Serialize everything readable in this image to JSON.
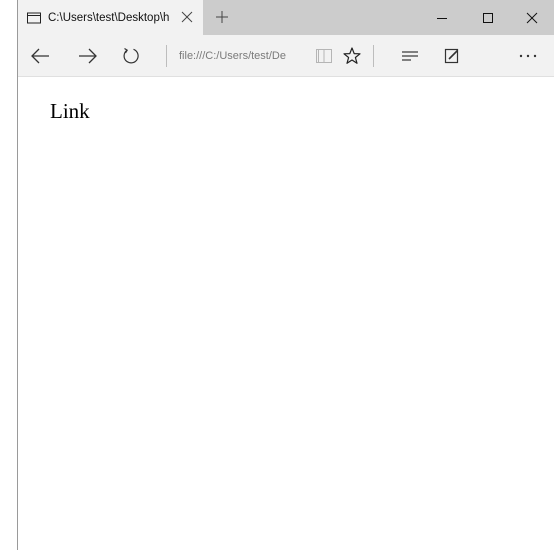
{
  "tab": {
    "title": "C:\\Users\\test\\Desktop\\h",
    "favicon": "window-icon",
    "close_icon": "close-icon"
  },
  "new_tab": {
    "icon": "plus-icon"
  },
  "window_controls": {
    "minimize": "minimize-icon",
    "maximize": "maximize-icon",
    "close": "close-icon"
  },
  "navbar": {
    "back_icon": "arrow-left-icon",
    "forward_icon": "arrow-right-icon",
    "refresh_icon": "refresh-icon",
    "address": "file:///C:/Users/test/De",
    "reading_view_icon": "book-icon",
    "favorite_icon": "star-icon",
    "hub_icon": "hub-icon",
    "web_note_icon": "pen-icon",
    "more_icon": "more-icon"
  },
  "page": {
    "link_text": "Link"
  },
  "colors": {
    "titlebar": "#cccccc",
    "active_tab": "#f2f2f2",
    "toolbar": "#f2f2f2",
    "page_bg": "#ffffff"
  }
}
